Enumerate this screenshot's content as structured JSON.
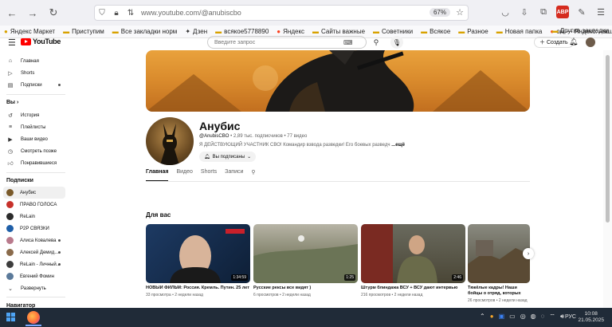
{
  "browser": {
    "url": "www.youtube.com/@anubiscbo",
    "zoom": "67%",
    "abp_label": "ABP"
  },
  "bookmarks": [
    {
      "label": "Яндекс Маркет"
    },
    {
      "label": "Приступим"
    },
    {
      "label": "Все закладки норм"
    },
    {
      "label": "Дзен"
    },
    {
      "label": "всякое5778890"
    },
    {
      "label": "Яндекс"
    },
    {
      "label": "Сайты важные"
    },
    {
      "label": "Советники"
    },
    {
      "label": "Всякое"
    },
    {
      "label": "Разное"
    },
    {
      "label": "Новая папка"
    },
    {
      "label": "ом — Яндекс: нашло..."
    }
  ],
  "bookmarks_right": "Другие закладки",
  "header": {
    "logo": "YouTube",
    "search_placeholder": "Введите запрос",
    "create_label": "Создать"
  },
  "sidebar": {
    "main": [
      {
        "label": "Главная",
        "icon": "home-icon"
      },
      {
        "label": "Shorts",
        "icon": "shorts-icon"
      },
      {
        "label": "Подписки",
        "icon": "subscriptions-icon"
      }
    ],
    "you_heading": "Вы",
    "you": [
      {
        "label": "История",
        "icon": "history-icon"
      },
      {
        "label": "Плейлисты",
        "icon": "playlists-icon"
      },
      {
        "label": "Ваши видео",
        "icon": "your-videos-icon"
      },
      {
        "label": "Смотреть позже",
        "icon": "watch-later-icon"
      },
      {
        "label": "Понравившиеся",
        "icon": "liked-icon"
      }
    ],
    "subs_heading": "Подписки",
    "subs": [
      {
        "label": "Анубис",
        "active": true
      },
      {
        "label": "ПРАВО ГОЛОСА"
      },
      {
        "label": "ReLain"
      },
      {
        "label": "P2P СВЯЗКИ"
      },
      {
        "label": "Алиса Ковалева"
      },
      {
        "label": "Алексей Демид..."
      },
      {
        "label": "ReLain - Личный..."
      },
      {
        "label": "Евгений Фомин"
      },
      {
        "label": "Развернуть"
      }
    ],
    "navigator_heading": "Навигатор"
  },
  "channel": {
    "name": "Анубис",
    "handle": "@AnubisCBO",
    "subscribers": "2,89 тыс. подписчиков",
    "videos": "77 видео",
    "description": "Я ДЕЙСТВУЮЩИЙ УЧАСТНИК СВО! Командир взвода разведки! Его боевых разведч",
    "more_label": "...ещё",
    "subscribed_label": "Вы подписаны"
  },
  "tabs": [
    {
      "label": "Главная",
      "active": true
    },
    {
      "label": "Видео"
    },
    {
      "label": "Shorts"
    },
    {
      "label": "Записи"
    }
  ],
  "section_title": "Для вас",
  "videos": [
    {
      "title": "НОВЫЙ ФИЛЬМ: Россия. Кремль. Путин. 25 лет",
      "meta": "33 просмотра • 2 недели назад",
      "duration": "1:34:59"
    },
    {
      "title": "Русские рексы все видят )",
      "meta": "6 просмотров • 2 недели назад",
      "duration": "1:25"
    },
    {
      "title": "Штурм блиндажа ВСУ + ВСУ дают интервью",
      "meta": "216 просмотров • 2 недели назад",
      "duration": "2:46"
    },
    {
      "title": "Тяжёлые кадры! Наши бойцы о отряд, которых ранило FPV дро",
      "meta": "26 просмотров • 2 недели назад",
      "duration": ""
    }
  ],
  "taskbar": {
    "language": "РУС",
    "time": "10:08",
    "date": "21.05.2025"
  }
}
